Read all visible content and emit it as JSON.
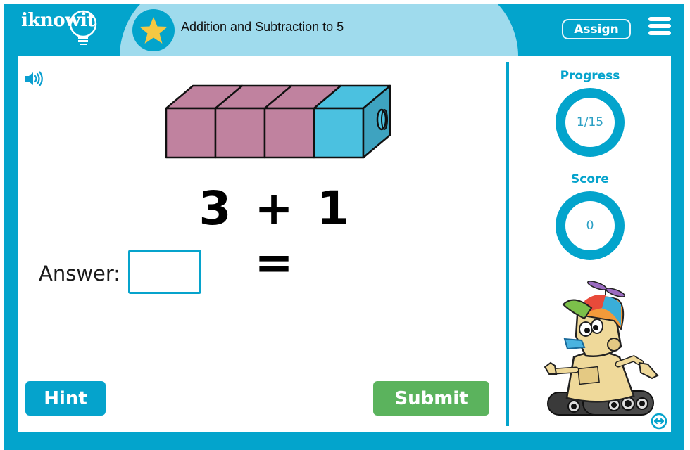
{
  "header": {
    "logo_text": "iknowit",
    "lesson_title": "Addition and Subtraction to 5",
    "star_icon": "star-icon",
    "assign_label": "Assign",
    "menu_icon": "hamburger-menu-icon"
  },
  "question": {
    "sound_icon": "speaker-icon",
    "blocks": {
      "pink_count": 3,
      "blue_count": 1,
      "pink_color": "#c0829f",
      "blue_color": "#4bc1e0"
    },
    "equation": "3 + 1 =",
    "answer_label": "Answer:",
    "answer_value": ""
  },
  "buttons": {
    "hint_label": "Hint",
    "submit_label": "Submit"
  },
  "sidebar": {
    "progress_label": "Progress",
    "progress_value": "1/15",
    "score_label": "Score",
    "score_value": "0",
    "mascot": "robot-mascot",
    "toggle_icon": "swap-horizontal-icon"
  },
  "colors": {
    "brand_blue": "#03a4cc",
    "header_light_blue": "#9fdbed",
    "submit_green": "#5bb35d",
    "star_yellow": "#f5c842"
  }
}
